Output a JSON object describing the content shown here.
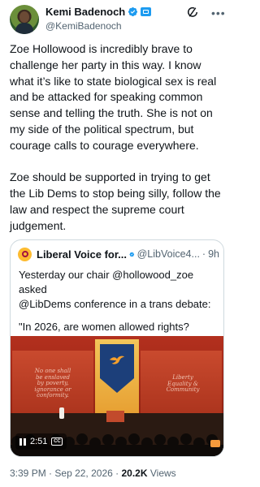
{
  "author": {
    "display_name": "Kemi Badenoch",
    "handle": "@KemiBadenoch"
  },
  "tweet": {
    "paragraphs": [
      "Zoe Hollowood is incredibly brave to challenge her party in this way.  I know what it’s like to state biological sex is real and be attacked for speaking common sense and telling the truth.  She is not on my side of the political spectrum, but courage calls to courage everywhere.",
      "Zoe should be supported in trying to get the Lib Dems to stop being silly, follow the law and respect the supreme court judgement."
    ]
  },
  "quote": {
    "display_name": "Liberal Voice for...",
    "handle": "@LibVoice4...",
    "separator": "·",
    "time": "9h",
    "lines": [
      "Yesterday our chair @hollowood_zoe asked",
      "@LibDems conference in a trans debate:",
      "\"In 2026, are women allowed rights?",
      "..."
    ],
    "video": {
      "duration": "2:51",
      "cc_label": "CC",
      "panel_left_text": [
        "No one shall",
        "be enslaved",
        "by poverty,",
        "ignorance or",
        "conformity."
      ],
      "panel_right_text": [
        "Liberty",
        "Equality &",
        "Community"
      ]
    }
  },
  "meta": {
    "time": "3:39 PM",
    "separator": "·",
    "date": "Sep 22, 2026",
    "views_count": "20.2K",
    "views_label": "Views"
  },
  "colors": {
    "verified_blue": "#1d9bf0",
    "text_primary": "#0f1419",
    "text_secondary": "#536471",
    "border": "#cfd9de",
    "libdem_gold": "#fdbb30"
  },
  "icons": {
    "verified": "verified-badge-icon",
    "affiliate": "government-affiliate-icon",
    "grok": "grok-icon",
    "more": "more-options-icon"
  }
}
